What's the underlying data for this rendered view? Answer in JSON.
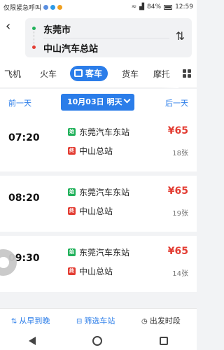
{
  "status_bar": {
    "carrier": "仅限紧急呼叫",
    "battery": "84%",
    "time": "12:59"
  },
  "header": {
    "from_city": "东莞市",
    "to_city": "中山汽车总站"
  },
  "tabs": [
    {
      "label": "飞机",
      "active": false
    },
    {
      "label": "火车",
      "active": false
    },
    {
      "label": "客车",
      "active": true
    },
    {
      "label": "货车",
      "active": false
    },
    {
      "label": "摩托",
      "active": false
    }
  ],
  "date_bar": {
    "prev_label": "前一天",
    "current": "10月03日 明天",
    "next_label": "后一天"
  },
  "trips": [
    {
      "time": "07:20",
      "start_badge": "始",
      "start_station": "东莞汽车东站",
      "end_badge": "终",
      "end_station": "中山总站",
      "price": "¥65",
      "seats": "18张"
    },
    {
      "time": "08:20",
      "start_badge": "始",
      "start_station": "东莞汽车东站",
      "end_badge": "终",
      "end_station": "中山总站",
      "price": "¥65",
      "seats": "19张"
    },
    {
      "time": "09:30",
      "start_badge": "始",
      "start_station": "东莞汽车东站",
      "end_badge": "终",
      "end_station": "中山总站",
      "price": "¥65",
      "seats": "14张"
    }
  ],
  "filter_bar": {
    "sort_label": "从早到晚",
    "station_label": "筛选车站",
    "time_label": "出发时段"
  },
  "colors": {
    "accent": "#2b7de9",
    "price": "#e33d33",
    "start": "#20b15a"
  }
}
